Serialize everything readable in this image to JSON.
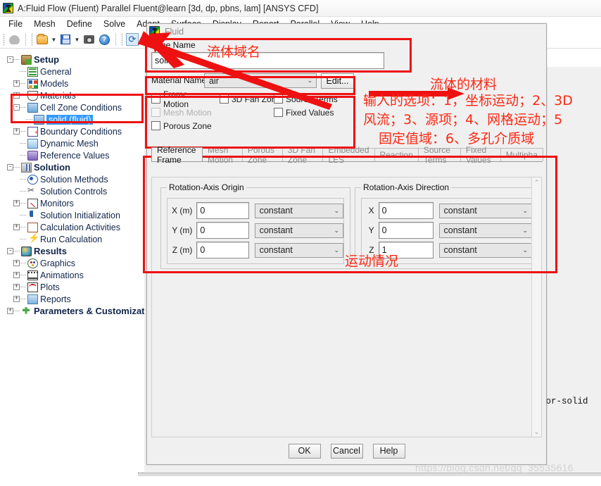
{
  "window": {
    "title": "A:Fluid Flow (Fluent) Parallel Fluent@learn  [3d, dp, pbns, lam] [ANSYS CFD]",
    "app_icon": "ansys-fluent-icon"
  },
  "menubar": {
    "items": [
      "File",
      "Mesh",
      "Define",
      "Solve",
      "Adapt",
      "Surface",
      "Display",
      "Report",
      "Parallel",
      "View",
      "Help"
    ]
  },
  "toolbar": {
    "buttons": [
      {
        "name": "mesh-display-icon",
        "glyph": "mesh"
      },
      {
        "name": "open-file-icon",
        "glyph": "folder"
      },
      {
        "name": "save-file-icon",
        "glyph": "save"
      },
      {
        "name": "screenshot-icon",
        "glyph": "camera"
      },
      {
        "name": "help-icon",
        "glyph": "help"
      },
      {
        "name": "refresh-icon",
        "glyph": "refresh"
      }
    ]
  },
  "tree": {
    "items": [
      {
        "label": "Setup",
        "level": 0,
        "expander": "-",
        "icon": "setup-icon",
        "bold": true
      },
      {
        "label": "General",
        "level": 1,
        "expander": "",
        "icon": "general-icon",
        "bold": false
      },
      {
        "label": "Models",
        "level": 1,
        "expander": "+",
        "icon": "models-icon",
        "bold": false
      },
      {
        "label": "Materials",
        "level": 1,
        "expander": "+",
        "icon": "materials-icon",
        "bold": false
      },
      {
        "label": "Cell Zone Conditions",
        "level": 1,
        "expander": "-",
        "icon": "cell-zone-icon",
        "bold": false
      },
      {
        "label": "solid (fluid)",
        "level": 2,
        "expander": "",
        "icon": "cell-zone-icon",
        "bold": false,
        "selected": true
      },
      {
        "label": "Boundary Conditions",
        "level": 1,
        "expander": "+",
        "icon": "boundary-conditions-icon",
        "bold": false
      },
      {
        "label": "Dynamic Mesh",
        "level": 1,
        "expander": "",
        "icon": "dynamic-mesh-icon",
        "bold": false
      },
      {
        "label": "Reference Values",
        "level": 1,
        "expander": "",
        "icon": "reference-values-icon",
        "bold": false
      },
      {
        "label": "Solution",
        "level": 0,
        "expander": "-",
        "icon": "solution-icon",
        "bold": true
      },
      {
        "label": "Solution Methods",
        "level": 1,
        "expander": "",
        "icon": "solution-methods-icon",
        "bold": false
      },
      {
        "label": "Solution Controls",
        "level": 1,
        "expander": "",
        "icon": "solution-controls-icon",
        "bold": false
      },
      {
        "label": "Monitors",
        "level": 1,
        "expander": "+",
        "icon": "monitors-icon",
        "bold": false
      },
      {
        "label": "Solution Initialization",
        "level": 1,
        "expander": "",
        "icon": "initialization-icon",
        "bold": false
      },
      {
        "label": "Calculation Activities",
        "level": 1,
        "expander": "+",
        "icon": "calculation-activities-icon",
        "bold": false
      },
      {
        "label": "Run Calculation",
        "level": 1,
        "expander": "",
        "icon": "run-calculation-icon",
        "bold": false
      },
      {
        "label": "Results",
        "level": 0,
        "expander": "-",
        "icon": "results-icon",
        "bold": true
      },
      {
        "label": "Graphics",
        "level": 1,
        "expander": "+",
        "icon": "graphics-icon",
        "bold": false
      },
      {
        "label": "Animations",
        "level": 1,
        "expander": "+",
        "icon": "animations-icon",
        "bold": false
      },
      {
        "label": "Plots",
        "level": 1,
        "expander": "+",
        "icon": "plots-icon",
        "bold": false
      },
      {
        "label": "Reports",
        "level": 1,
        "expander": "+",
        "icon": "reports-icon",
        "bold": false
      },
      {
        "label": "Parameters & Customizat",
        "level": 0,
        "expander": "+",
        "icon": "parameters-icon",
        "bold": true
      }
    ]
  },
  "dialog": {
    "title": "Fluid",
    "zone_name_label": "Zone Name",
    "zone_name_value": "solid",
    "material_name_label": "Material Name",
    "material_name_value": "air",
    "edit_button": "Edit...",
    "checkboxes": [
      {
        "label": "Frame Motion",
        "checked": false,
        "disabled": false
      },
      {
        "label": "3D Fan Zone",
        "checked": false,
        "disabled": false
      },
      {
        "label": "Source Terms",
        "checked": false,
        "disabled": false
      },
      {
        "label": "Mesh Motion",
        "checked": false,
        "disabled": true
      },
      {
        "label": "Fixed Values",
        "checked": false,
        "disabled": false
      },
      {
        "label": "Porous Zone",
        "checked": false,
        "disabled": false
      }
    ],
    "tabs": [
      {
        "label": "Reference Frame",
        "active": true
      },
      {
        "label": "Mesh Motion",
        "active": false
      },
      {
        "label": "Porous Zone",
        "active": false
      },
      {
        "label": "3D Fan Zone",
        "active": false
      },
      {
        "label": "Embedded LES",
        "active": false
      },
      {
        "label": "Reaction",
        "active": false
      },
      {
        "label": "Source Terms",
        "active": false
      },
      {
        "label": "Fixed Values",
        "active": false
      },
      {
        "label": "Multipha",
        "active": false
      }
    ],
    "rotation_axis_origin": {
      "title": "Rotation-Axis Origin",
      "rows": [
        {
          "label": "X (m)",
          "value": "0",
          "profile": "constant"
        },
        {
          "label": "Y (m)",
          "value": "0",
          "profile": "constant"
        },
        {
          "label": "Z (m)",
          "value": "0",
          "profile": "constant"
        }
      ]
    },
    "rotation_axis_direction": {
      "title": "Rotation-Axis Direction",
      "rows": [
        {
          "label": "X",
          "value": "0",
          "profile": "constant"
        },
        {
          "label": "Y",
          "value": "0",
          "profile": "constant"
        },
        {
          "label": "Z",
          "value": "1",
          "profile": "constant"
        }
      ]
    },
    "footer": {
      "ok": "OK",
      "cancel": "Cancel",
      "help": "Help"
    }
  },
  "console": {
    "line": "Setting zone id of interior-solid"
  },
  "annotations": {
    "color": "#fb2a15",
    "zone_name_note": "流体域名",
    "material_note": "流体的材料",
    "options_note_line1": "输入的选项：1，坐标运动；2、3D",
    "options_note_line2": "风流；3、源项；4、网格运动；5",
    "options_note_line3": "固定值域：6、多孔介质域",
    "motion_note": "运动情况"
  },
  "watermark": "https://blog.csdn.net/qq_35535616"
}
